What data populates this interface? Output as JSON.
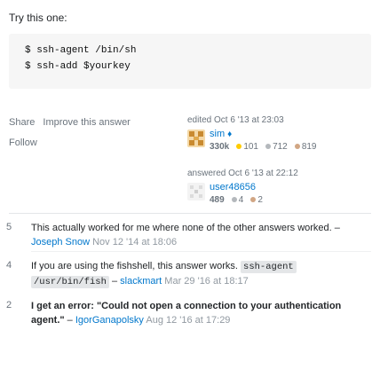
{
  "intro": "Try this one:",
  "code_lines": [
    "$ ssh-agent /bin/sh",
    "$ ssh-add $yourkey"
  ],
  "post_menu": {
    "share": "Share",
    "improve": "Improve this answer",
    "follow": "Follow"
  },
  "edited": {
    "action": "edited Oct 6 '13 at 23:03",
    "user": "sim",
    "diamond": "♦",
    "reputation": "330k",
    "gold": "101",
    "silver": "712",
    "bronze": "819"
  },
  "answered": {
    "action": "answered Oct 6 '13 at 22:12",
    "user": "user48656",
    "reputation": "489",
    "silver": "4",
    "bronze": "2"
  },
  "comments": [
    {
      "score": "5",
      "text": "This actually worked for me where none of the other answers worked.",
      "author": "Joseph Snow",
      "date": "Nov 12 '14 at 18:06"
    },
    {
      "score": "4",
      "text_before": "If you are using the fishshell, this answer works.",
      "code1": "ssh-agent",
      "code2": "/usr/bin/fish",
      "author": "slackmart",
      "date": "Mar 29 '16 at 18:17"
    },
    {
      "score": "2",
      "text": "I get an error: \"Could not open a connection to your authentication agent.\"",
      "author": "IgorGanapolsky",
      "date": "Aug 12 '16 at 17:29"
    }
  ],
  "dash": "–",
  "colors": {
    "link": "#0077cc",
    "muted": "#6a737c",
    "gold": "#ffcc01",
    "silver": "#b4b8bc",
    "bronze": "#d1a684"
  }
}
